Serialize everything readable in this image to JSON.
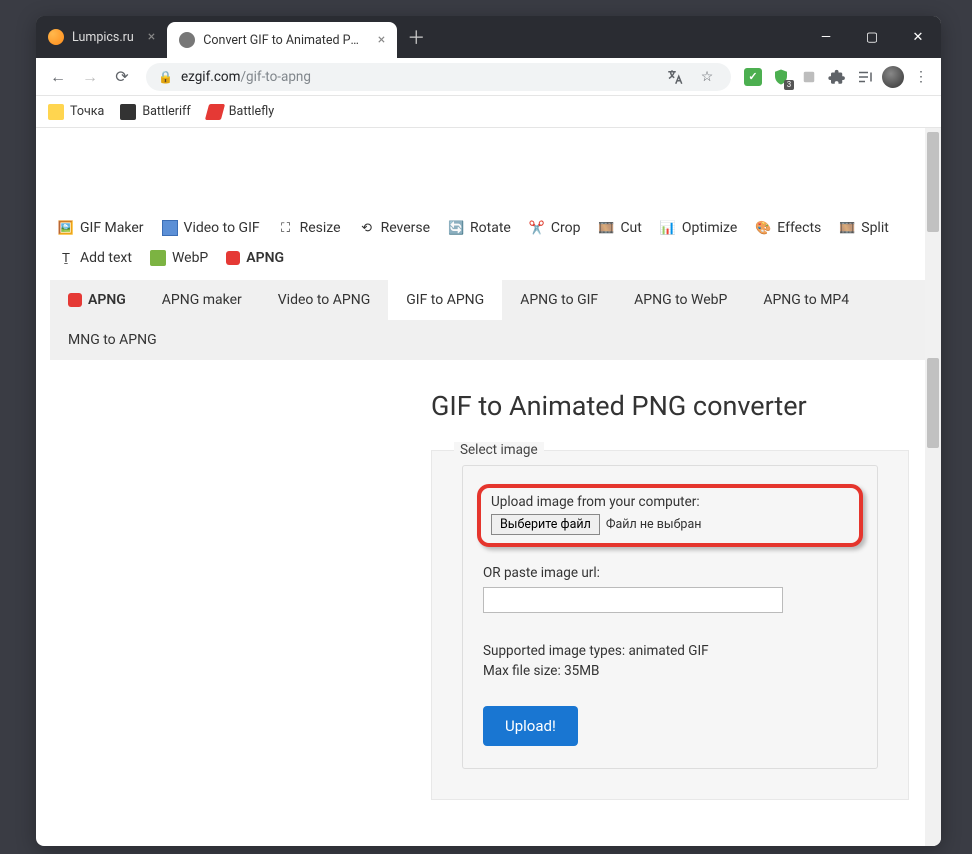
{
  "tabs": [
    {
      "title": "Lumpics.ru"
    },
    {
      "title": "Convert GIF to Animated PNG"
    }
  ],
  "url": {
    "domain": "ezgif.com",
    "path": "/gif-to-apng"
  },
  "bookmarks": [
    {
      "label": "Точка"
    },
    {
      "label": "Battleriff"
    },
    {
      "label": "Battlefly"
    }
  ],
  "mainnav": {
    "gifmaker": "GIF Maker",
    "videotogif": "Video to GIF",
    "resize": "Resize",
    "reverse": "Reverse",
    "rotate": "Rotate",
    "crop": "Crop",
    "cut": "Cut",
    "optimize": "Optimize",
    "effects": "Effects",
    "split": "Split",
    "addtext": "Add text",
    "webp": "WebP",
    "apng": "APNG"
  },
  "subnav": {
    "brand": "APNG",
    "apngmaker": "APNG maker",
    "videotoapng": "Video to APNG",
    "giftoapng": "GIF to APNG",
    "apngtogif": "APNG to GIF",
    "apngtowebp": "APNG to WebP",
    "apngtomp4": "APNG to MP4",
    "mngtoapng": "MNG to APNG"
  },
  "page": {
    "heading": "GIF to Animated PNG converter",
    "fieldset": "Select image",
    "upload_label": "Upload image from your computer:",
    "file_button": "Выберите файл",
    "file_status": "Файл не выбран",
    "or_label": "OR paste image url:",
    "supported": "Supported image types: animated GIF",
    "maxsize": "Max file size: 35MB",
    "upload_btn": "Upload!"
  },
  "shield_badge": "3"
}
